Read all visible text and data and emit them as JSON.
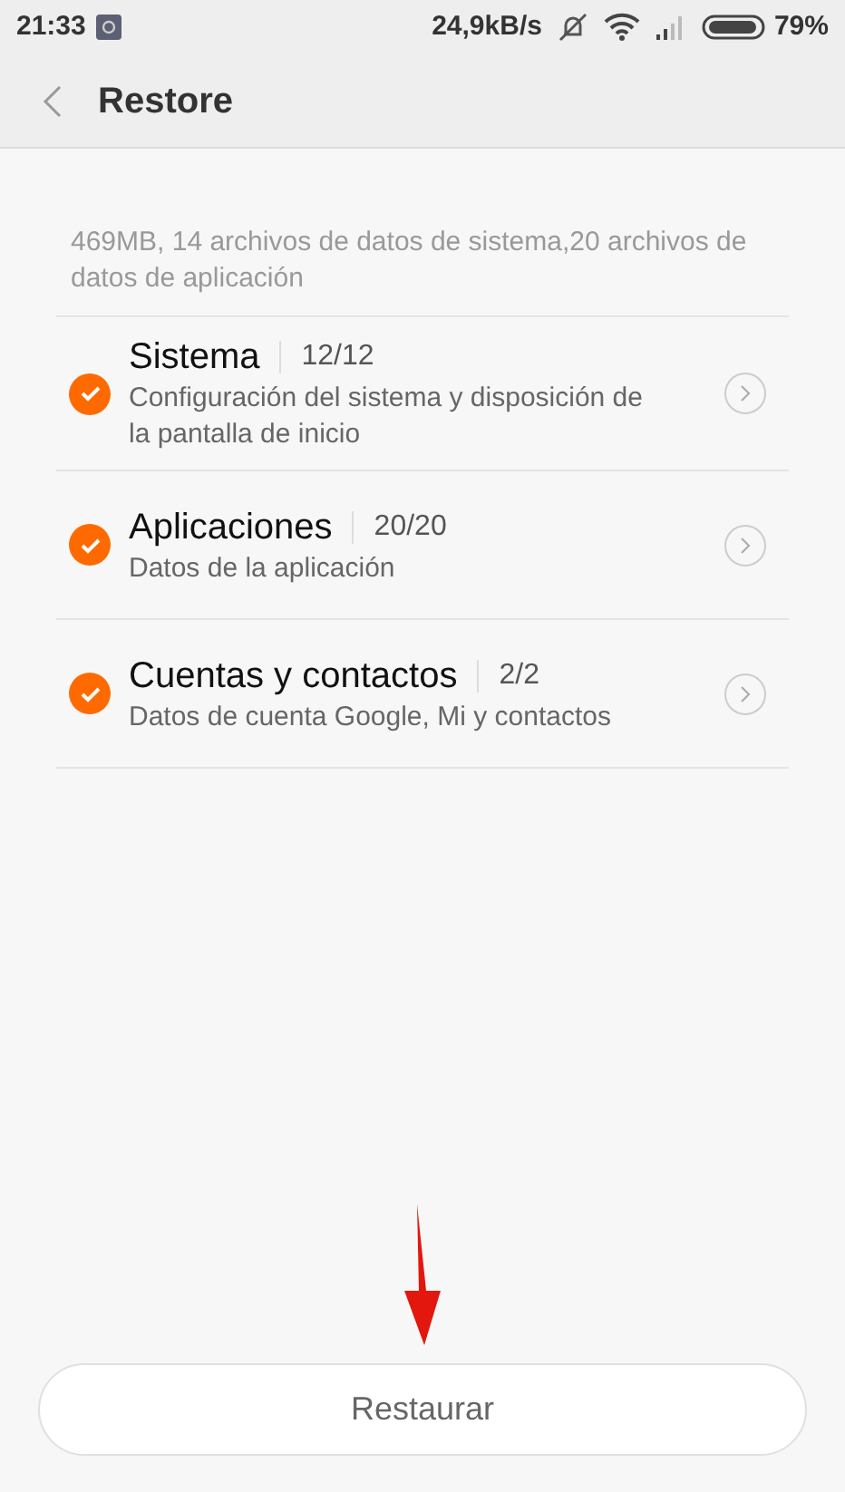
{
  "status_bar": {
    "time": "21:33",
    "speed": "24,9kB/s",
    "battery": "79%"
  },
  "header": {
    "title": "Restore"
  },
  "summary": "469MB, 14 archivos de datos de sistema,20 archivos de datos de aplicación",
  "items": [
    {
      "title": "Sistema",
      "count": "12/12",
      "description": "Configuración del sistema y disposición de la pantalla de inicio",
      "checked": true
    },
    {
      "title": "Aplicaciones",
      "count": "20/20",
      "description": "Datos de la aplicación",
      "checked": true
    },
    {
      "title": "Cuentas y contactos",
      "count": "2/2",
      "description": "Datos de cuenta Google, Mi y contactos",
      "checked": true
    }
  ],
  "button": {
    "label": "Restaurar"
  }
}
